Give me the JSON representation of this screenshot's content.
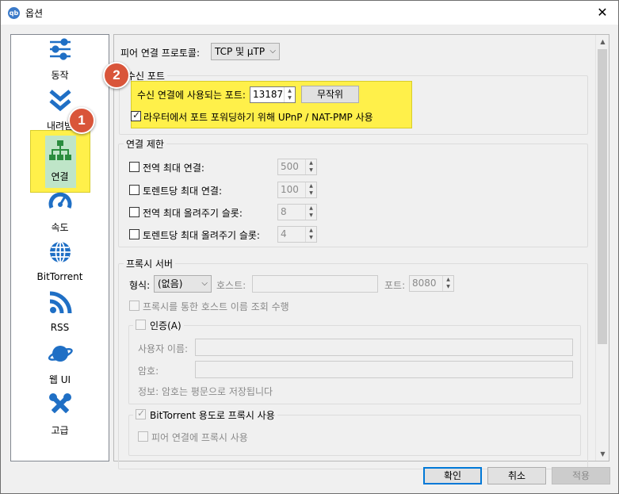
{
  "window": {
    "title": "옵션",
    "app_icon": "qb"
  },
  "sidebar": {
    "items": [
      {
        "label": "동작",
        "icon": "sliders-icon"
      },
      {
        "label": "내려받",
        "icon": "download-chevrons-icon"
      },
      {
        "label": "연결",
        "icon": "network-icon"
      },
      {
        "label": "속도",
        "icon": "speedometer-icon"
      },
      {
        "label": "BitTorrent",
        "icon": "globe-icon"
      },
      {
        "label": "RSS",
        "icon": "rss-icon"
      },
      {
        "label": "웹 UI",
        "icon": "planet-icon"
      },
      {
        "label": "고급",
        "icon": "tools-icon"
      }
    ],
    "selected": "연결"
  },
  "main": {
    "protocol_label": "피어 연결 프로토콜:",
    "protocol_value": "TCP 및 µTP",
    "listen_port": {
      "title": "수신 포트",
      "port_label": "수신 연결에 사용되는 포트:",
      "port_value": "13187",
      "random_button": "무작위",
      "upnp_label": "라우터에서 포트 포워딩하기 위해 UPnP / NAT-PMP 사용",
      "upnp_checked": true
    },
    "conn_limits": {
      "title": "연결 제한",
      "rows": [
        {
          "label": "전역 최대 연결:",
          "value": "500"
        },
        {
          "label": "토렌트당 최대 연결:",
          "value": "100"
        },
        {
          "label": "전역 최대 올려주기 슬롯:",
          "value": "8"
        },
        {
          "label": "토렌트당 최대 올려주기 슬롯:",
          "value": "4"
        }
      ]
    },
    "proxy": {
      "title": "프록시 서버",
      "type_label": "형식:",
      "type_value": "(없음)",
      "host_label": "호스트:",
      "port_label": "포트:",
      "port_value": "8080",
      "hostname_lookup_label": "프록시를 통한 호스트 이름 조회 수행",
      "auth": {
        "title": "인증(A)",
        "username_label": "사용자 이름:",
        "password_label": "암호:",
        "info": "정보: 암호는 평문으로 저장됩니다"
      },
      "bt_proxy": {
        "title": "BitTorrent 용도로 프록시 사용",
        "peer_label": "피어 연결에 프록시 사용"
      }
    }
  },
  "footer": {
    "ok": "확인",
    "cancel": "취소",
    "apply": "적용"
  },
  "badges": {
    "one": "1",
    "two": "2"
  },
  "colors": {
    "highlight": "#fff04a",
    "badge": "#d9553a",
    "icon_blue": "#1f6fc5",
    "icon_green": "#2a8c3e"
  }
}
